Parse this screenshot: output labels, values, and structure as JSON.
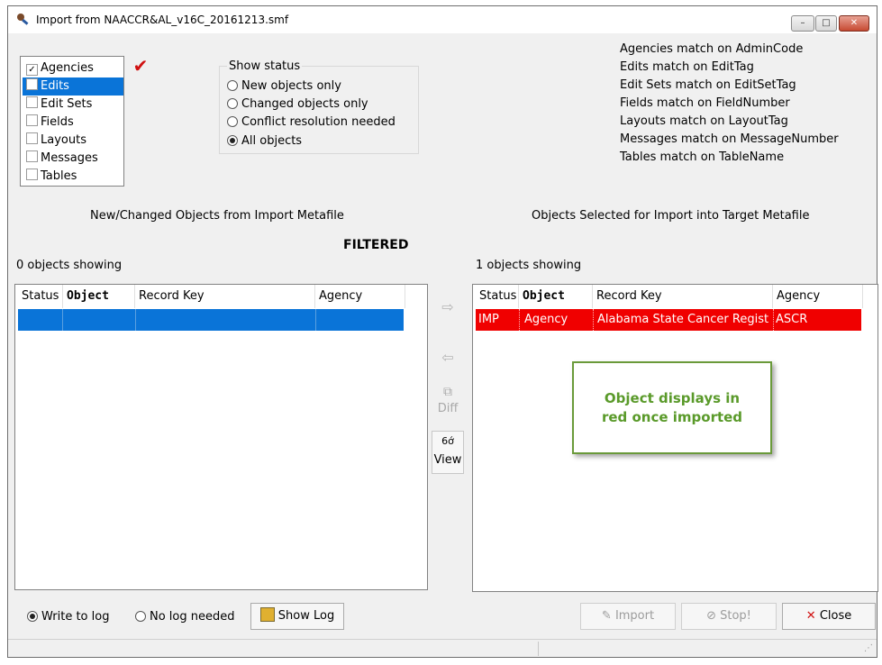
{
  "window": {
    "title": "Import from NAACCR&AL_v16C_20161213.smf",
    "min_glyph": "–",
    "max_glyph": "□",
    "close_glyph": "✕"
  },
  "object_types": {
    "items": [
      {
        "label": "Agencies",
        "checked": true,
        "selected": false
      },
      {
        "label": "Edits",
        "checked": false,
        "selected": true
      },
      {
        "label": "Edit Sets",
        "checked": false,
        "selected": false
      },
      {
        "label": "Fields",
        "checked": false,
        "selected": false
      },
      {
        "label": "Layouts",
        "checked": false,
        "selected": false
      },
      {
        "label": "Messages",
        "checked": false,
        "selected": false
      },
      {
        "label": "Tables",
        "checked": false,
        "selected": false
      }
    ],
    "checkmark": "✔"
  },
  "show_status": {
    "title": "Show status",
    "options": [
      "New objects only",
      "Changed objects only",
      "Conflict resolution needed",
      "All objects"
    ],
    "selected": "All objects"
  },
  "match_info": [
    "Agencies match on AdminCode",
    "Edits match on EditTag",
    "Edit Sets match on EditSetTag",
    "Fields match on FieldNumber",
    "Layouts match on LayoutTag",
    "Messages match on MessageNumber",
    "Tables match on TableName"
  ],
  "left_panel": {
    "heading": "New/Changed Objects from Import Metafile",
    "filter_label": "FILTERED",
    "count_label": "0 objects showing",
    "columns": [
      "Status",
      "Object",
      "Record Key",
      "Agency"
    ]
  },
  "right_panel": {
    "heading": "Objects Selected for Import into Target Metafile",
    "count_label": "1 objects showing",
    "columns": [
      "Status",
      "Object",
      "Record Key",
      "Agency"
    ],
    "rows": [
      {
        "status": "IMP",
        "object": "Agency",
        "record_key": "Alabama State Cancer Regist",
        "agency": "ASCR"
      }
    ],
    "row_color": "#f00000"
  },
  "middle_buttons": {
    "add_glyph": "⇨",
    "remove_glyph": "⇦",
    "diff_label": "Diff",
    "view_glyph": "6ớ",
    "view_label": "View"
  },
  "callout": {
    "text": "Object displays in red once imported",
    "border_color": "#6a9a3a",
    "text_color": "#5a9a2a"
  },
  "bottom": {
    "log_options": [
      "Write to log",
      "No log needed"
    ],
    "log_selected": "Write to log",
    "show_log_label": "Show Log",
    "import_label": "Import",
    "stop_label": "Stop!",
    "close_label": "Close",
    "close_glyph": "✕"
  },
  "colors": {
    "selection": "#0a74d8",
    "imported_row": "#f00000",
    "close_x": "#d01010"
  }
}
